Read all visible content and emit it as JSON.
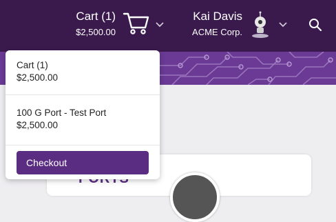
{
  "header": {
    "cart_title": "Cart (1)",
    "cart_amount": "$2,500.00",
    "user_name": "Kai Davis",
    "user_org": "ACME Corp."
  },
  "background": {
    "section_heading": "PORTS"
  },
  "cart_dropdown": {
    "summary_title": "Cart (1)",
    "summary_amount": "$2,500.00",
    "items": [
      {
        "name": "100 G Port - Test Port",
        "price": "$2,500.00"
      }
    ],
    "checkout_label": "Checkout"
  },
  "colors": {
    "header_bg": "#3a1a4d",
    "banner_bg": "#6a3a94",
    "accent": "#5a2d82"
  },
  "icons": [
    "cart-icon",
    "chevron-down-icon",
    "avatar",
    "search-icon"
  ]
}
